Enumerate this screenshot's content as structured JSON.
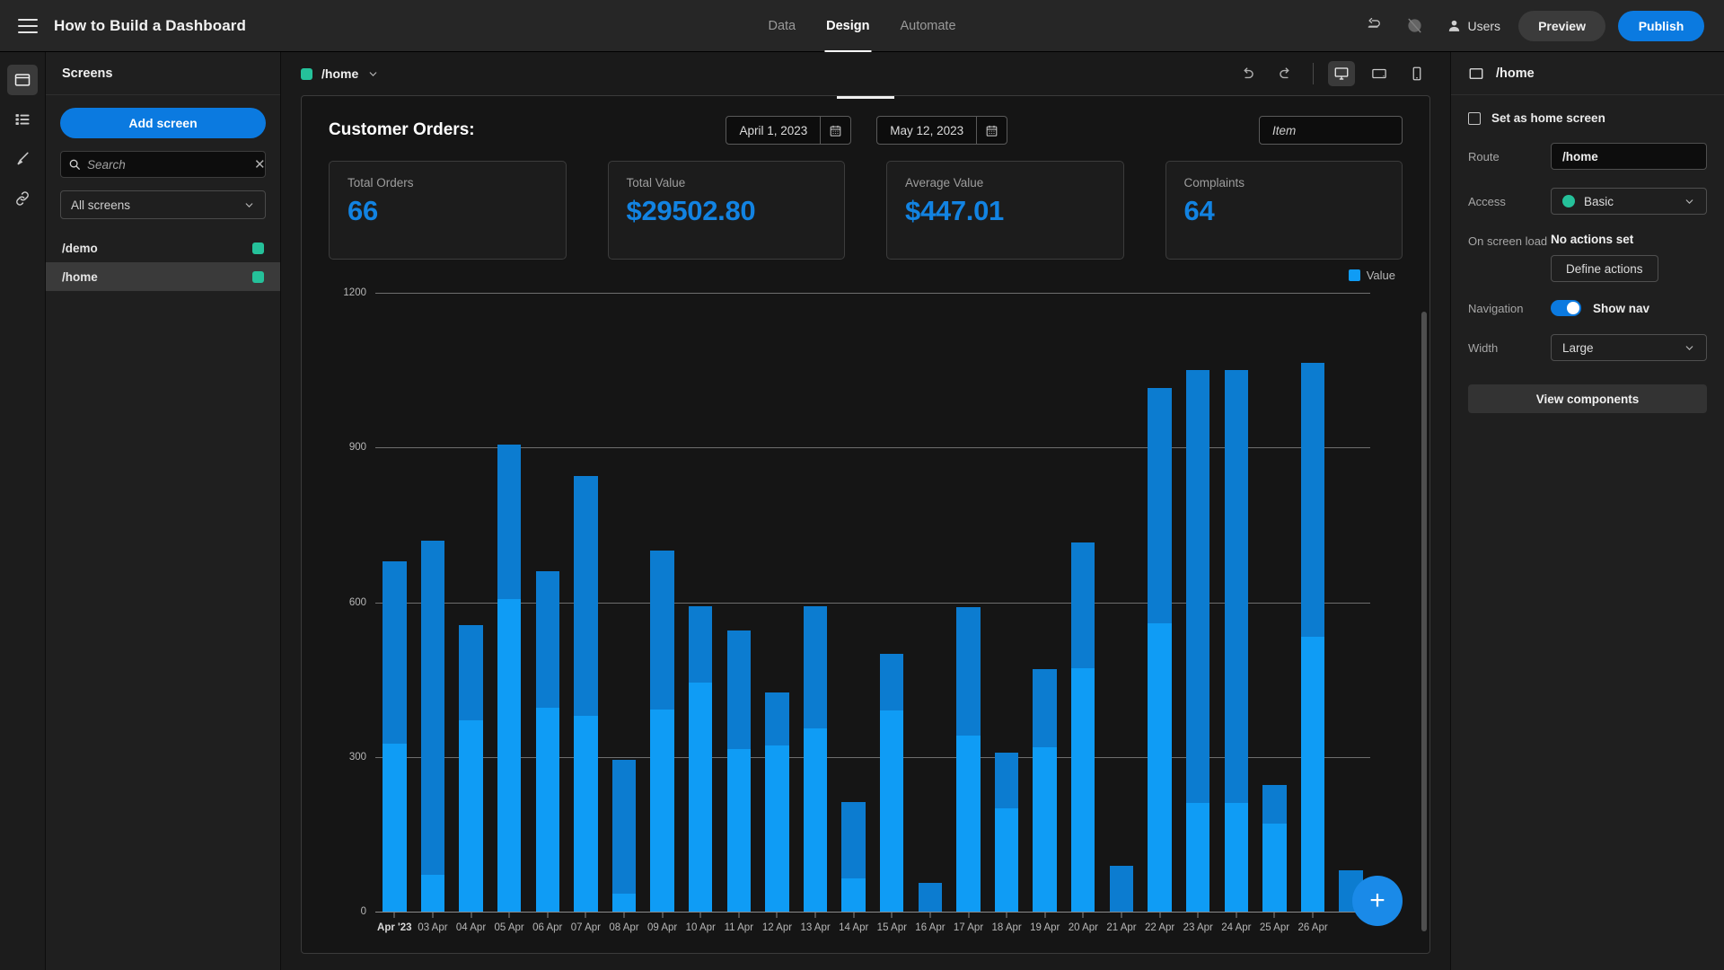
{
  "topbar": {
    "app_title": "How to Build a Dashboard",
    "menu_icon": "hamburger-icon",
    "tabs": [
      {
        "label": "Data",
        "active": false
      },
      {
        "label": "Design",
        "active": true
      },
      {
        "label": "Automate",
        "active": false
      }
    ],
    "undo_icon": "undo-icon",
    "theme_icon": "theme-slash-icon",
    "users_label": "Users",
    "preview_label": "Preview",
    "publish_label": "Publish"
  },
  "rail": {
    "items": [
      {
        "name": "screens-icon",
        "active": true
      },
      {
        "name": "data-list-icon",
        "active": false
      },
      {
        "name": "theme-brush-icon",
        "active": false
      },
      {
        "name": "link-icon",
        "active": false
      }
    ]
  },
  "screens_panel": {
    "heading": "Screens",
    "add_button": "Add screen",
    "search_placeholder": "Search",
    "search_value": "",
    "filter_selected": "All screens",
    "screens": [
      {
        "route": "/demo",
        "active": false,
        "access_color": "#25c19a"
      },
      {
        "route": "/home",
        "active": true,
        "access_color": "#25c19a"
      }
    ]
  },
  "canvas_header": {
    "route": "/home",
    "route_color": "#25c19a",
    "undo_icon": "undo-icon",
    "redo_icon": "redo-icon",
    "devices": [
      {
        "name": "desktop-icon",
        "active": true
      },
      {
        "name": "tablet-icon",
        "active": false
      },
      {
        "name": "mobile-icon",
        "active": false
      }
    ]
  },
  "dashboard": {
    "title": "Customer Orders:",
    "date_from": "April 1, 2023",
    "date_to": "May 12, 2023",
    "calendar_icon": "calendar-icon",
    "item_placeholder": "Item",
    "item_value": "",
    "cards": [
      {
        "label": "Total Orders",
        "value": "66"
      },
      {
        "label": "Total Value",
        "value": "$29502.80"
      },
      {
        "label": "Average Value",
        "value": "$447.01"
      },
      {
        "label": "Complaints",
        "value": "64"
      }
    ],
    "add_component_icon": "plus-icon"
  },
  "chart_data": {
    "type": "bar",
    "title": "Customer Orders:",
    "xlabel": "",
    "ylabel": "",
    "ylim": [
      0,
      1200
    ],
    "yticks": [
      0,
      300,
      600,
      900,
      1200
    ],
    "grid": true,
    "legend_position": "top-right",
    "legend": [
      {
        "name": "Value",
        "color": "#0f9cf5"
      }
    ],
    "bar_color": "#0f9cf5",
    "overlay_color": "#0c7cd0",
    "categories": [
      "Apr '23",
      "03 Apr",
      "04 Apr",
      "05 Apr",
      "06 Apr",
      "07 Apr",
      "08 Apr",
      "09 Apr",
      "10 Apr",
      "11 Apr",
      "12 Apr",
      "13 Apr",
      "14 Apr",
      "15 Apr",
      "16 Apr",
      "17 Apr",
      "18 Apr",
      "19 Apr",
      "20 Apr",
      "21 Apr",
      "22 Apr",
      "23 Apr",
      "24 Apr",
      "25 Apr",
      "26 Apr"
    ],
    "series": [
      {
        "name": "Value",
        "values": [
          680,
          720,
          555,
          905,
          660,
          845,
          295,
          700,
          592,
          545,
          425,
          592,
          212,
          500,
          55,
          590,
          308,
          470,
          715,
          88,
          1015,
          1050,
          1050,
          245,
          1065,
          80
        ]
      }
    ]
  },
  "right_panel": {
    "screen_icon": "screen-icon",
    "title": "/home",
    "home_checkbox_label": "Set as home screen",
    "home_checkbox_checked": false,
    "route_label": "Route",
    "route_value": "/home",
    "access_label": "Access",
    "access_value": "Basic",
    "access_color": "#25c19a",
    "onload_label": "On screen load",
    "onload_value": "No actions set",
    "define_actions_label": "Define actions",
    "navigation_label": "Navigation",
    "nav_toggle_on": true,
    "nav_toggle_text": "Show nav",
    "width_label": "Width",
    "width_value": "Large",
    "view_components_label": "View components"
  }
}
